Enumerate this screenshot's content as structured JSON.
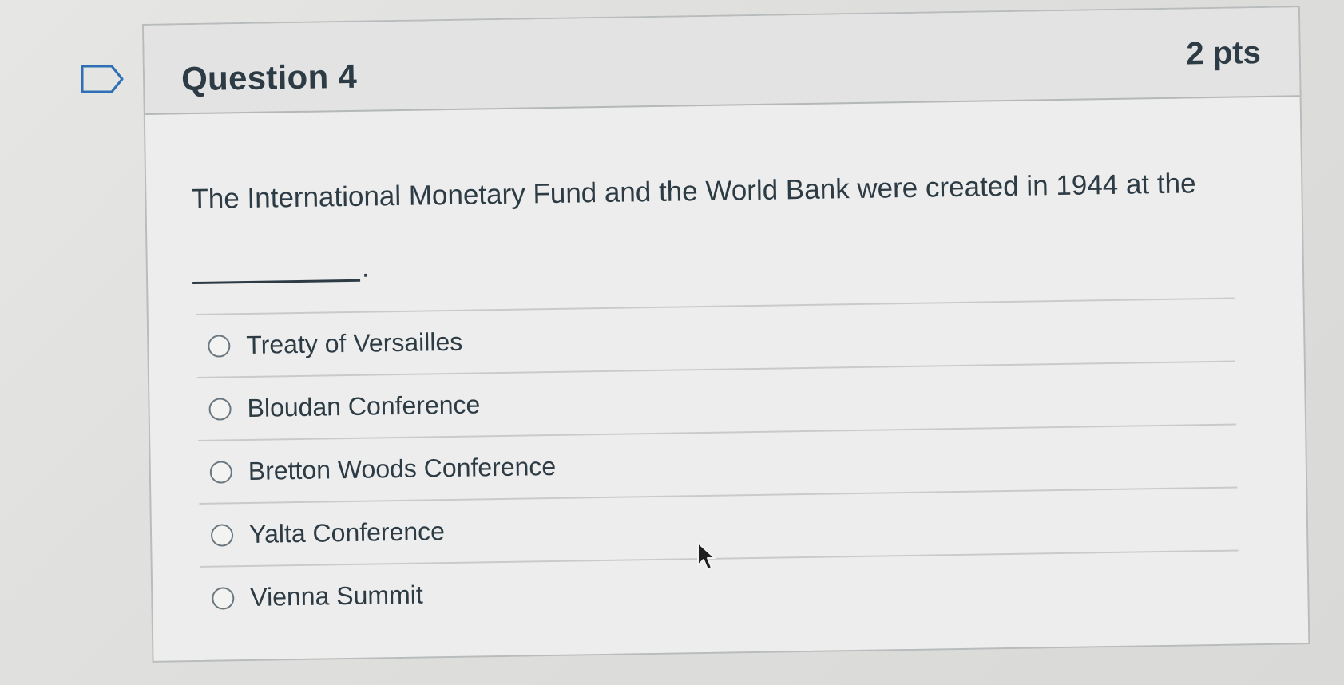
{
  "question": {
    "title": "Question 4",
    "points": "2 pts",
    "text": "The International Monetary Fund and the World Bank were created in 1944 at the",
    "blank_suffix": "."
  },
  "answers": [
    {
      "label": "Treaty of Versailles",
      "selected": false
    },
    {
      "label": "Bloudan Conference",
      "selected": false
    },
    {
      "label": "Bretton Woods Conference",
      "selected": false
    },
    {
      "label": "Yalta Conference",
      "selected": false
    },
    {
      "label": "Vienna Summit",
      "selected": false
    }
  ],
  "icons": {
    "bookmark": "bookmark-flag-icon",
    "radio": "radio-unchecked-icon",
    "cursor": "mouse-pointer-icon"
  },
  "colors": {
    "text": "#2d3b45",
    "border": "#b9bcbc",
    "background": "#ecedec"
  }
}
